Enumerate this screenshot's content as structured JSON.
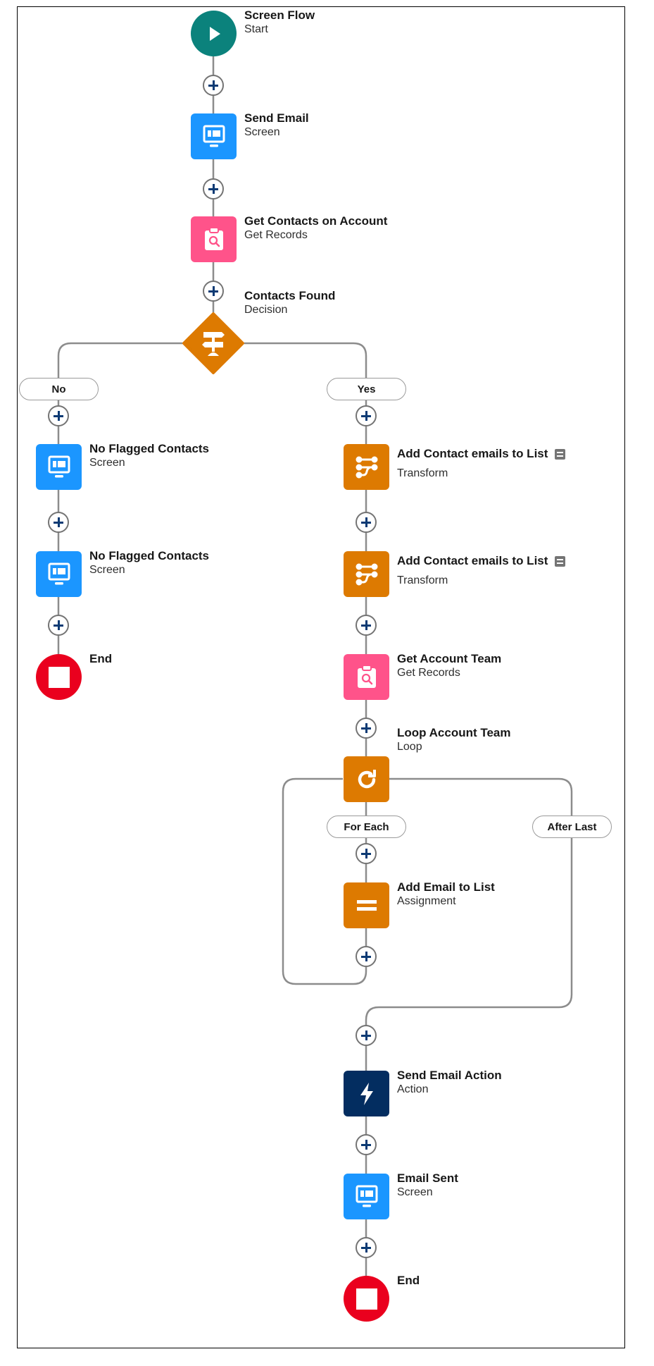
{
  "canvas": {
    "colors": {
      "start": "#0b827c",
      "screen": "#1b96ff",
      "get_records": "#ff538a",
      "decision": "#dd7a01",
      "transform": "#dd7a01",
      "loop": "#dd7a01",
      "assignment": "#dd7a01",
      "action": "#032d60",
      "end": "#ea001e",
      "connector": "#8c8c8c",
      "add_icon": "#0b3a74"
    },
    "add_element_label": "+"
  },
  "nodes": {
    "start": {
      "title": "Screen Flow",
      "type": "Start",
      "icon": "play-icon"
    },
    "send_email": {
      "title": "Send Email",
      "type": "Screen",
      "icon": "screen-icon"
    },
    "get_contacts": {
      "title": "Get Contacts on Account",
      "type": "Get Records",
      "icon": "clipboard-search-icon"
    },
    "contacts_found": {
      "title": "Contacts Found",
      "type": "Decision",
      "icon": "signpost-icon"
    },
    "no_flagged_1": {
      "title": "No Flagged Contacts",
      "type": "Screen",
      "icon": "screen-icon"
    },
    "no_flagged_2": {
      "title": "No Flagged Contacts",
      "type": "Screen",
      "icon": "screen-icon"
    },
    "end_left": {
      "title": "End",
      "icon": "stop-icon"
    },
    "transform_1": {
      "title": "Add Contact emails to List",
      "type": "Transform",
      "icon": "transform-icon",
      "has_description": true
    },
    "transform_2": {
      "title": "Add Contact emails to List",
      "type": "Transform",
      "icon": "transform-icon",
      "has_description": true
    },
    "get_account_team": {
      "title": "Get Account Team",
      "type": "Get Records",
      "icon": "clipboard-search-icon"
    },
    "loop_account_team": {
      "title": "Loop Account Team",
      "type": "Loop",
      "icon": "loop-icon"
    },
    "add_email_to_list": {
      "title": "Add Email to List",
      "type": "Assignment",
      "icon": "assignment-icon"
    },
    "send_email_action": {
      "title": "Send Email Action",
      "type": "Action",
      "icon": "lightning-icon"
    },
    "email_sent": {
      "title": "Email Sent",
      "type": "Screen",
      "icon": "screen-icon"
    },
    "end_right": {
      "title": "End",
      "icon": "stop-icon"
    }
  },
  "branches": {
    "no": "No",
    "yes": "Yes",
    "for_each": "For Each",
    "after_last": "After Last"
  }
}
